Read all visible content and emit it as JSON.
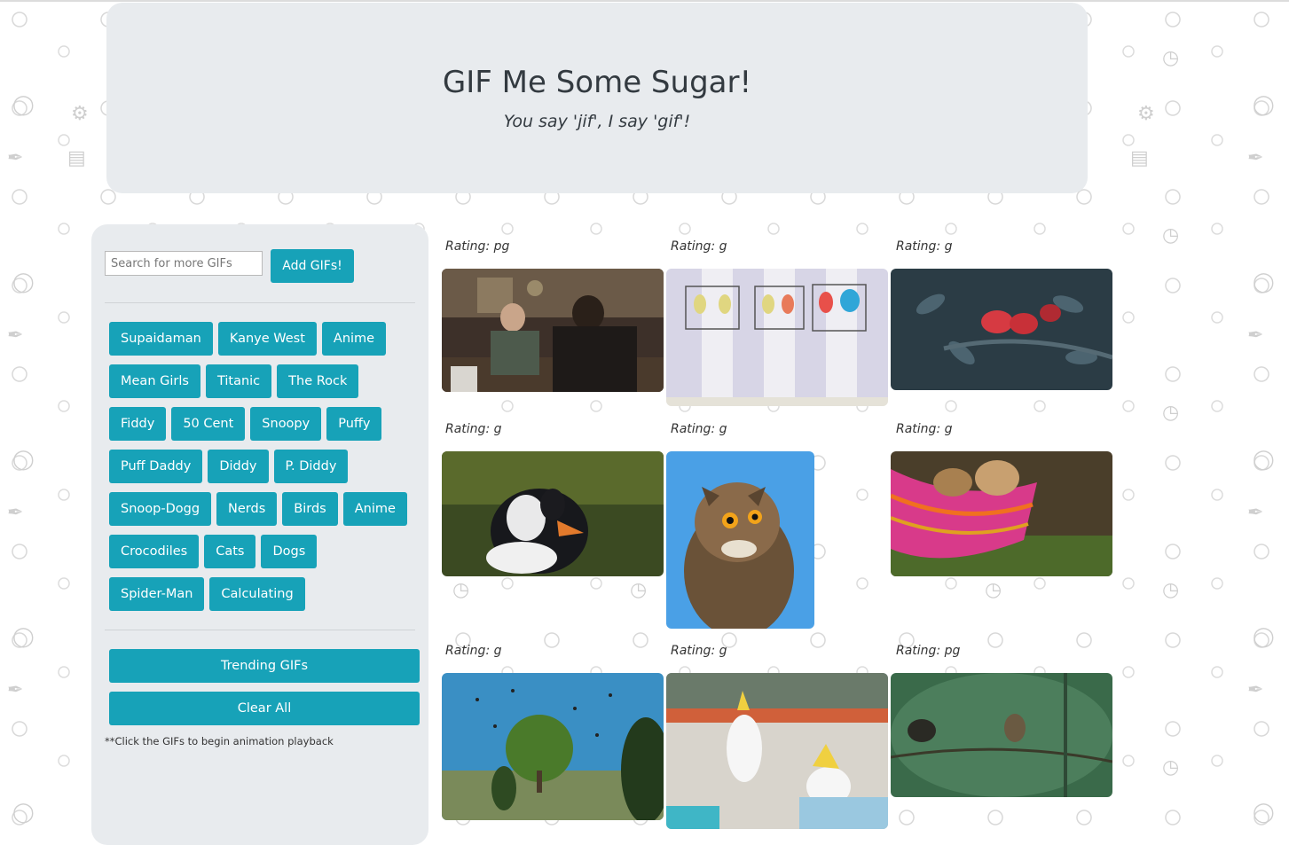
{
  "header": {
    "title": "GIF Me Some Sugar!",
    "subtitle": "You say 'jif', I say 'gif'!"
  },
  "search": {
    "placeholder": "Search for more GIFs",
    "value": "",
    "add_label": "Add GIFs!"
  },
  "topics": [
    "Supaidaman",
    "Kanye West",
    "Anime",
    "Mean Girls",
    "Titanic",
    "The Rock",
    "Fiddy",
    "50 Cent",
    "Snoopy",
    "Puffy",
    "Puff Daddy",
    "Diddy",
    "P. Diddy",
    "Snoop-Dogg",
    "Nerds",
    "Birds",
    "Anime",
    "Crocodiles",
    "Cats",
    "Dogs",
    "Spider-Man",
    "Calculating"
  ],
  "actions": {
    "trending_label": "Trending GIFs",
    "clear_label": "Clear All"
  },
  "hint": "**Click the GIFs to begin animation playback",
  "gifs": [
    {
      "rating": "Rating: pg",
      "scene": "meeting-room"
    },
    {
      "rating": "Rating: g",
      "scene": "cartoon-birdcages"
    },
    {
      "rating": "Rating: g",
      "scene": "red-birds-on-branch"
    },
    {
      "rating": "Rating: g",
      "scene": "puffin"
    },
    {
      "rating": "Rating: g",
      "scene": "owl"
    },
    {
      "rating": "Rating: g",
      "scene": "chicks-in-basket"
    },
    {
      "rating": "Rating: g",
      "scene": "birds-over-tree"
    },
    {
      "rating": "Rating: g",
      "scene": "cockatoos"
    },
    {
      "rating": "Rating: pg",
      "scene": "small-birds-on-branch"
    }
  ],
  "colors": {
    "accent": "#17a2b8",
    "panel": "#e8ebee"
  }
}
